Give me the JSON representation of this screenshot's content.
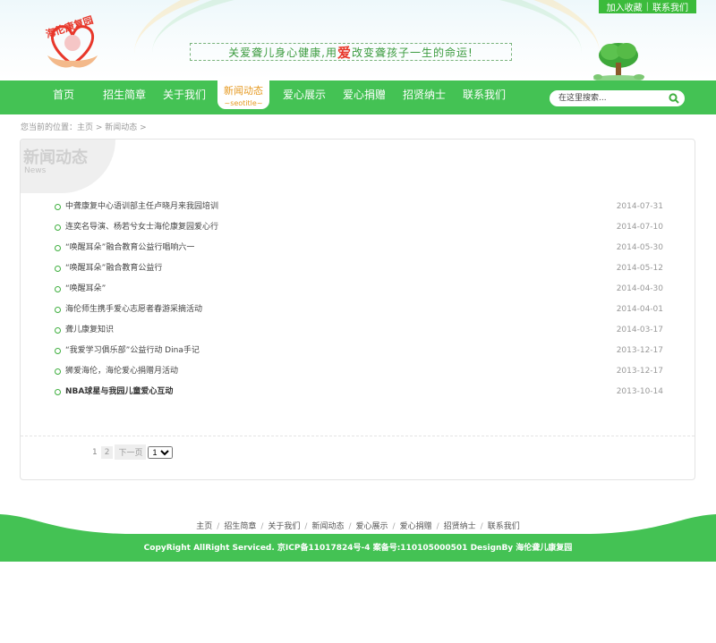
{
  "header": {
    "top_links": [
      "加入收藏",
      "联系我们"
    ],
    "logo_text": "海伦康复园",
    "slogan_before": "关爱聋儿身心健康,用",
    "slogan_love": "爱",
    "slogan_after": "改变聋孩子一生的命运!"
  },
  "nav": {
    "items": [
      "首页",
      "招生简章",
      "关于我们",
      "新闻动态",
      "爱心展示",
      "爱心捐赠",
      "招贤纳士",
      "联系我们"
    ],
    "active_sub": "~seotitle~",
    "search_placeholder": "在这里搜索..."
  },
  "breadcrumb": "您当前的位置：主页 > 新闻动态 >",
  "panel": {
    "title": "新闻动态",
    "subtitle": "News"
  },
  "news": [
    {
      "title": "中聋康复中心语训部主任卢晓月来我园培训",
      "date": "2014-07-31"
    },
    {
      "title": "连奕名导演、杨若兮女士海伦康复园爱心行",
      "date": "2014-07-10"
    },
    {
      "title": "“唤醒耳朵”融合教育公益行唱响六一",
      "date": "2014-05-30"
    },
    {
      "title": "“唤醒耳朵”融合教育公益行",
      "date": "2014-05-12"
    },
    {
      "title": "“唤醒耳朵”",
      "date": "2014-04-30"
    },
    {
      "title": "海伦师生携手爱心志愿者春游采摘活动",
      "date": "2014-04-01"
    },
    {
      "title": "聋儿康复知识",
      "date": "2014-03-17"
    },
    {
      "title": "“我爱学习俱乐部”公益行动 Dina手记",
      "date": "2013-12-17"
    },
    {
      "title": "狮爱海伦，海伦爱心捐赠月活动",
      "date": "2013-12-17"
    },
    {
      "title": "NBA球星与我园儿童爱心互动",
      "date": "2013-10-14",
      "bold": true
    }
  ],
  "pager": {
    "page1": "1",
    "page2": "2",
    "next": "下一页",
    "selected": "1"
  },
  "footer": {
    "links": [
      "主页",
      "招生简章",
      "关于我们",
      "新闻动态",
      "爱心展示",
      "爱心捐赠",
      "招贤纳士",
      "联系我们"
    ],
    "copyright": "CopyRight AllRight Serviced. 京ICP备11017824号-4 案备号:110105000501 DesignBy 海伦聋儿康复园"
  },
  "colors": {
    "brand_green": "#44c254",
    "accent_orange": "#e69a22",
    "accent_red": "#e8372a"
  }
}
